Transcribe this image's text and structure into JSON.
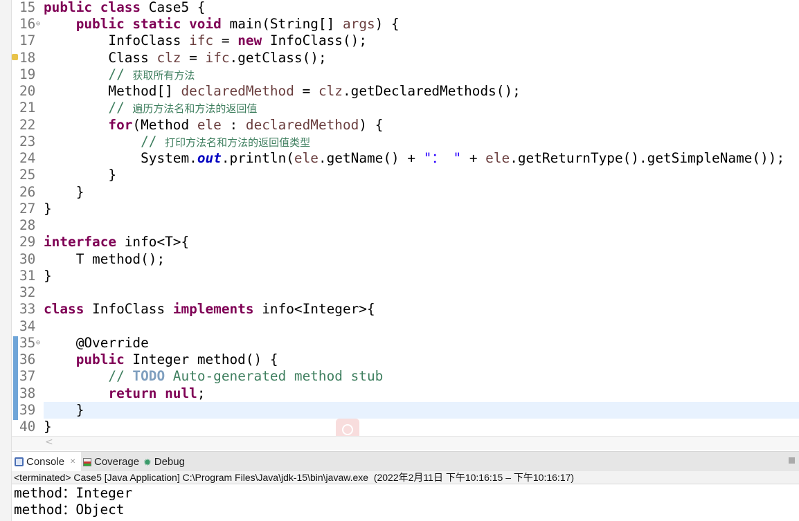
{
  "editor": {
    "current_line": 39,
    "lines": [
      {
        "n": "15",
        "t": [
          [
            "public class ",
            "kw"
          ],
          [
            "Case5 {",
            "pl"
          ]
        ]
      },
      {
        "n": "16",
        "fold": true,
        "t": [
          [
            "    public static void ",
            "kw"
          ],
          [
            "main(String[] ",
            "pl"
          ],
          [
            "args",
            "var"
          ],
          [
            ") {",
            "pl"
          ]
        ]
      },
      {
        "n": "17",
        "t": [
          [
            "        InfoClass ",
            "pl"
          ],
          [
            "ifc",
            "var"
          ],
          [
            " = ",
            "pl"
          ],
          [
            "new ",
            "kw"
          ],
          [
            "InfoClass();",
            "pl"
          ]
        ]
      },
      {
        "n": "18",
        "warn": true,
        "t": [
          [
            "        Class ",
            "pl"
          ],
          [
            "clz",
            "var"
          ],
          [
            " = ",
            "pl"
          ],
          [
            "ifc",
            "var"
          ],
          [
            ".getClass();",
            "pl"
          ]
        ]
      },
      {
        "n": "19",
        "t": [
          [
            "        // ",
            "cm"
          ],
          [
            "获取所有方法",
            "cm cmcn"
          ]
        ]
      },
      {
        "n": "20",
        "t": [
          [
            "        Method[] ",
            "pl"
          ],
          [
            "declaredMethod",
            "var"
          ],
          [
            " = ",
            "pl"
          ],
          [
            "clz",
            "var"
          ],
          [
            ".getDeclaredMethods();",
            "pl"
          ]
        ]
      },
      {
        "n": "21",
        "t": [
          [
            "        // ",
            "cm"
          ],
          [
            "遍历方法名和方法的返回值",
            "cm cmcn"
          ]
        ]
      },
      {
        "n": "22",
        "t": [
          [
            "        for",
            "kw"
          ],
          [
            "(Method ",
            "pl"
          ],
          [
            "ele",
            "var"
          ],
          [
            " : ",
            "pl"
          ],
          [
            "declaredMethod",
            "var"
          ],
          [
            ") {",
            "pl"
          ]
        ]
      },
      {
        "n": "23",
        "t": [
          [
            "            // ",
            "cm"
          ],
          [
            "打印方法名和方法的返回值类型",
            "cm cmcn"
          ]
        ]
      },
      {
        "n": "24",
        "t": [
          [
            "            System.",
            "pl"
          ],
          [
            "out",
            "fld"
          ],
          [
            ".println(",
            "pl"
          ],
          [
            "ele",
            "var"
          ],
          [
            ".getName() + ",
            "pl"
          ],
          [
            "\"： \"",
            "str"
          ],
          [
            " + ",
            "pl"
          ],
          [
            "ele",
            "var"
          ],
          [
            ".getReturnType().getSimpleName());",
            "pl"
          ]
        ]
      },
      {
        "n": "25",
        "t": [
          [
            "        }",
            "pl"
          ]
        ]
      },
      {
        "n": "26",
        "t": [
          [
            "    }",
            "pl"
          ]
        ]
      },
      {
        "n": "27",
        "t": [
          [
            "}",
            "pl"
          ]
        ]
      },
      {
        "n": "28",
        "t": []
      },
      {
        "n": "29",
        "t": [
          [
            "interface ",
            "kw"
          ],
          [
            "info<T>{",
            "pl"
          ]
        ]
      },
      {
        "n": "30",
        "t": [
          [
            "    T method();",
            "pl"
          ]
        ]
      },
      {
        "n": "31",
        "t": [
          [
            "}",
            "pl"
          ]
        ]
      },
      {
        "n": "32",
        "t": []
      },
      {
        "n": "33",
        "t": [
          [
            "class ",
            "kw"
          ],
          [
            "InfoClass ",
            "pl"
          ],
          [
            "implements ",
            "kw"
          ],
          [
            "info<Integer>{",
            "pl"
          ]
        ]
      },
      {
        "n": "34",
        "t": []
      },
      {
        "n": "35",
        "fold": true,
        "t": [
          [
            "    @Override",
            "pl"
          ]
        ]
      },
      {
        "n": "36",
        "t": [
          [
            "    public ",
            "kw"
          ],
          [
            "Integer method() {",
            "pl"
          ]
        ]
      },
      {
        "n": "37",
        "t": [
          [
            "        // ",
            "cm"
          ],
          [
            "TODO",
            "todo"
          ],
          [
            " Auto-generated method stub",
            "cm"
          ]
        ]
      },
      {
        "n": "38",
        "t": [
          [
            "        return null",
            "kw"
          ],
          [
            ";",
            "pl"
          ]
        ]
      },
      {
        "n": "39",
        "t": [
          [
            "    }",
            "pl"
          ]
        ]
      },
      {
        "n": "40",
        "t": [
          [
            "}",
            "pl"
          ]
        ]
      }
    ]
  },
  "console": {
    "tabs": [
      {
        "label": "Console",
        "icon": "console-icon",
        "active": true,
        "close": "✕"
      },
      {
        "label": "Coverage",
        "icon": "coverage-icon"
      },
      {
        "label": "Debug",
        "icon": "debug-icon"
      }
    ],
    "status": "<terminated> Case5 [Java Application] C:\\Program Files\\Java\\jdk-15\\bin\\javaw.exe  (2022年2月11日 下午10:16:15 – 下午10:16:17)",
    "output": [
      "method：Integer",
      "method：Object"
    ]
  },
  "colors": {
    "keyword": "#7f0055",
    "variable": "#6a3e3e",
    "comment": "#3f7f5f",
    "string": "#2a00ff",
    "current_line": "#e8f2fe"
  }
}
